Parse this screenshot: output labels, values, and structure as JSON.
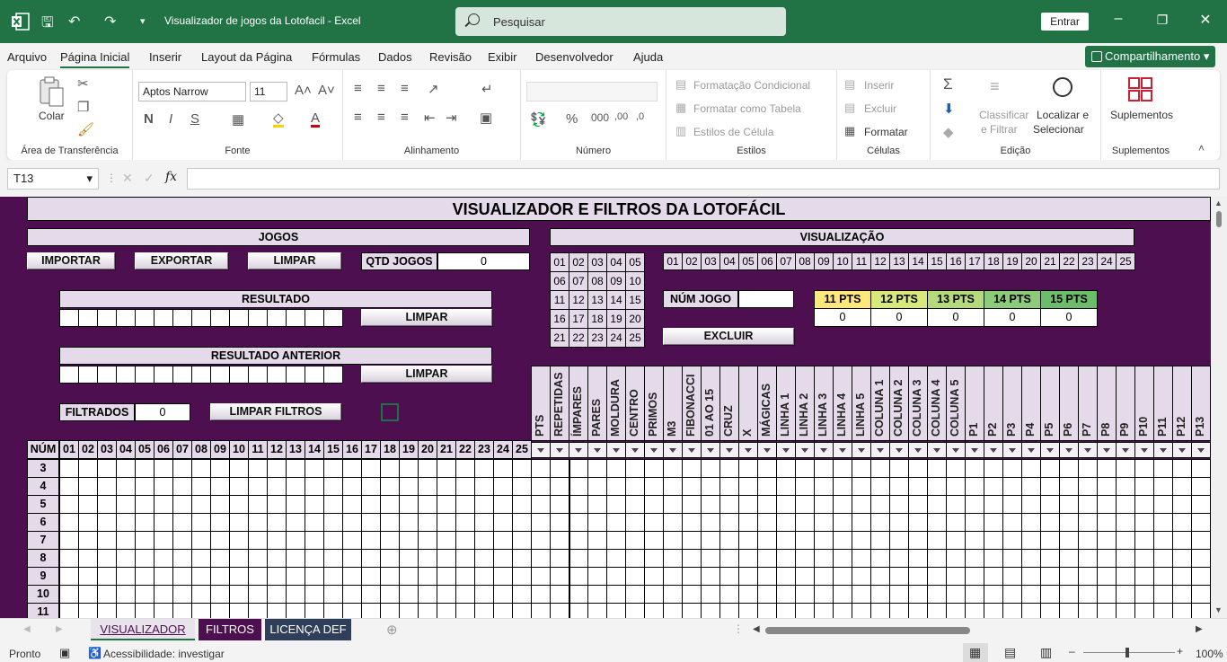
{
  "window": {
    "title": "Visualizador de jogos da Lotofacil  -  Excel",
    "search_placeholder": "Pesquisar",
    "signin": "Entrar"
  },
  "menu": {
    "tabs": [
      "Arquivo",
      "Página Inicial",
      "Inserir",
      "Layout da Página",
      "Fórmulas",
      "Dados",
      "Revisão",
      "Exibir",
      "Desenvolvedor",
      "Ajuda"
    ],
    "share": "Compartilhamento"
  },
  "ribbon": {
    "clipboard": {
      "paste": "Colar",
      "label": "Área de Transferência"
    },
    "font": {
      "name": "Aptos Narrow",
      "size": "11",
      "label": "Fonte"
    },
    "alignment": {
      "label": "Alinhamento"
    },
    "number": {
      "label": "Número"
    },
    "styles": {
      "cond": "Formatação Condicional",
      "table": "Formatar como Tabela",
      "cell": "Estilos de Célula",
      "label": "Estilos"
    },
    "cells": {
      "insert": "Inserir",
      "delete": "Excluir",
      "format": "Formatar",
      "label": "Células"
    },
    "edit": {
      "sort1": "Classificar",
      "sort2": "e Filtrar",
      "find1": "Localizar e",
      "find2": "Selecionar",
      "label": "Edição"
    },
    "addins": {
      "button": "Suplementos",
      "label": "Suplementos"
    }
  },
  "formula_bar": {
    "name_box": "T13",
    "formula": ""
  },
  "sheet": {
    "title": "VISUALIZADOR E FILTROS DA LOTOFÁCIL",
    "jogos_header": "JOGOS",
    "visualizacao_header": "VISUALIZAÇÃO",
    "btn_importar": "IMPORTAR",
    "btn_exportar": "EXPORTAR",
    "btn_limpar": "LIMPAR",
    "qtd_label": "QTD JOGOS",
    "qtd_value": "0",
    "resultado": "RESULTADO",
    "resultado_anterior": "RESULTADO ANTERIOR",
    "btn_limpar_res": "LIMPAR",
    "btn_limpar_ant": "LIMPAR",
    "filtrados_label": "FILTRADOS",
    "filtrados_value": "0",
    "btn_limpar_filtros": "LIMPAR FILTROS",
    "num_jogo_label": "NÚM JOGO",
    "btn_excluir": "EXCLUIR",
    "pts_labels": [
      "11 PTS",
      "12 PTS",
      "13 PTS",
      "14 PTS",
      "15 PTS"
    ],
    "pts_values": [
      "0",
      "0",
      "0",
      "0",
      "0"
    ],
    "pts_colors": [
      "#ffe77a",
      "#d8e87a",
      "#b4da7c",
      "#8ccb7a",
      "#6cbd6a"
    ],
    "grid5": [
      "01",
      "02",
      "03",
      "04",
      "05",
      "06",
      "07",
      "08",
      "09",
      "10",
      "11",
      "12",
      "13",
      "14",
      "15",
      "16",
      "17",
      "18",
      "19",
      "20",
      "21",
      "22",
      "23",
      "24",
      "25"
    ],
    "num_header": "NÚM",
    "filter_headers": [
      "PTS",
      "REPETIDAS",
      "ÍMPARES",
      "PARES",
      "MOLDURA",
      "CENTRO",
      "PRIMOS",
      "M3",
      "FIBONACCI",
      "01 AO 15",
      "CRUZ",
      "X",
      "MÁGICAS",
      "LINHA 1",
      "LINHA 2",
      "LINHA 3",
      "LINHA 4",
      "LINHA 5",
      "COLUNA 1",
      "COLUNA 2",
      "COLUNA 3",
      "COLUNA 4",
      "COLUNA 5",
      "P1",
      "P2",
      "P3",
      "P4",
      "P5",
      "P6",
      "P7",
      "P8",
      "P9",
      "P10",
      "P11",
      "P12",
      "P13"
    ],
    "row_numbers": [
      "3",
      "4",
      "5",
      "6",
      "7",
      "8",
      "9",
      "10",
      "11"
    ]
  },
  "sheet_tabs": [
    {
      "label": "VISUALIZADOR",
      "bg": "#e9e3ec",
      "fg": "#4d0f50"
    },
    {
      "label": "FILTROS",
      "bg": "#4d0f50",
      "fg": "#ffffff"
    },
    {
      "label": "LICENÇA DEF",
      "bg": "#2f3f5a",
      "fg": "#ffffff"
    }
  ],
  "status": {
    "ready": "Pronto",
    "accessibility": "Acessibilidade: investigar",
    "zoom": "100%"
  }
}
